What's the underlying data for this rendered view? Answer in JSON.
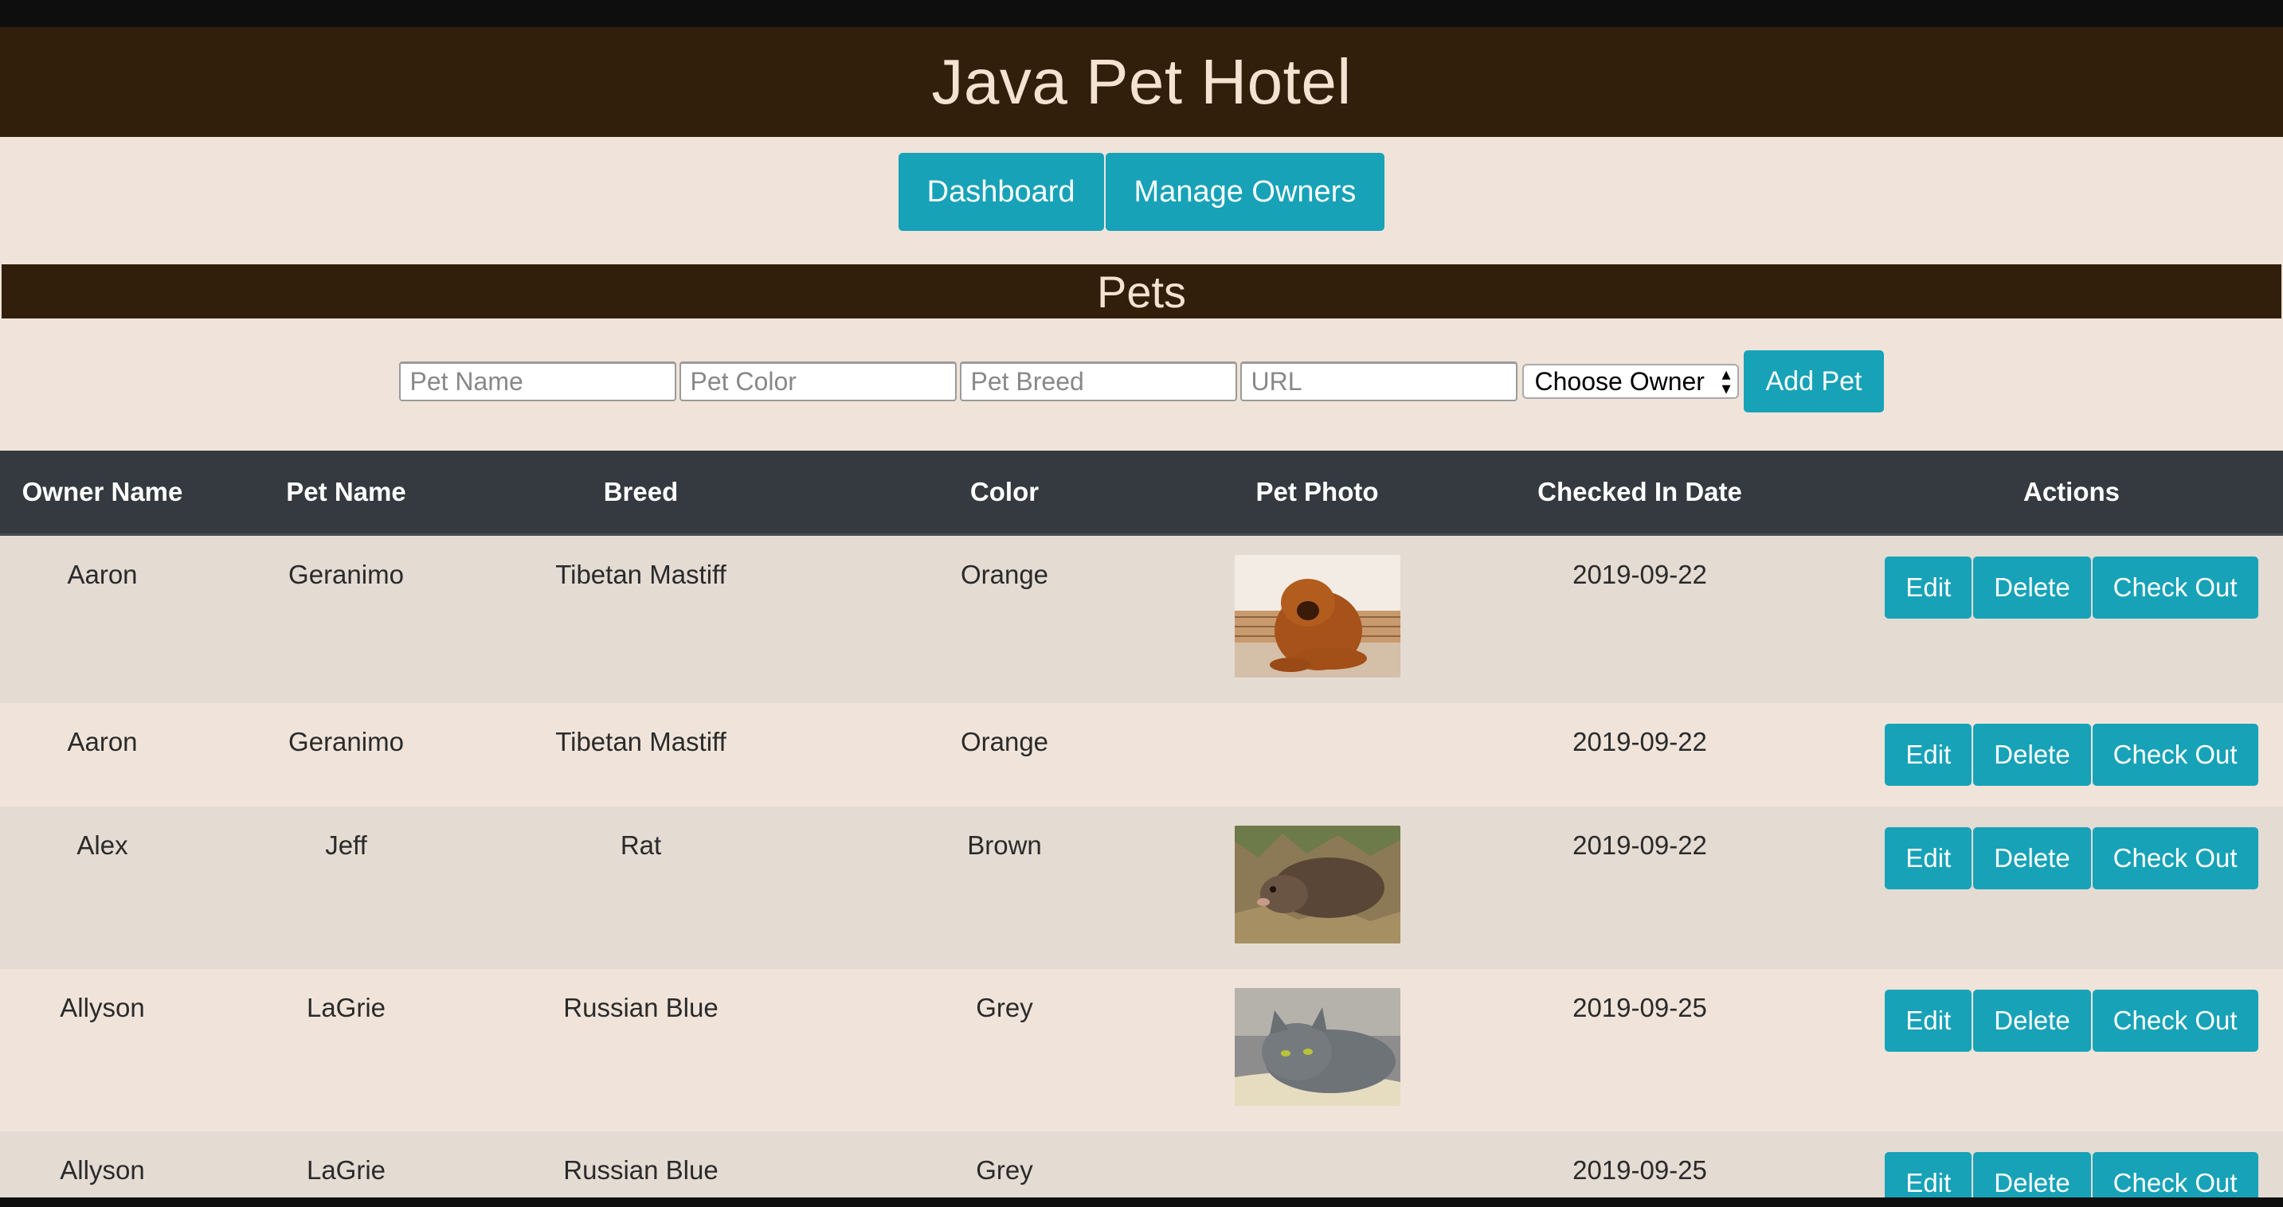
{
  "app": {
    "title": "Java Pet Hotel"
  },
  "nav": {
    "dashboard": "Dashboard",
    "manage_owners": "Manage Owners"
  },
  "section": {
    "title": "Pets"
  },
  "form": {
    "pet_name_placeholder": "Pet Name",
    "pet_color_placeholder": "Pet Color",
    "pet_breed_placeholder": "Pet Breed",
    "url_placeholder": "URL",
    "owner_select": "Choose Owner",
    "add_button": "Add Pet"
  },
  "table": {
    "headers": [
      "Owner Name",
      "Pet Name",
      "Breed",
      "Color",
      "Pet Photo",
      "Checked In Date",
      "Actions"
    ],
    "action_labels": {
      "edit": "Edit",
      "delete": "Delete",
      "checkout": "Check Out"
    },
    "rows": [
      {
        "owner": "Aaron",
        "pet": "Geranimo",
        "breed": "Tibetan Mastiff",
        "color": "Orange",
        "photo": "tibetan-mastiff-photo",
        "date": "2019-09-22"
      },
      {
        "owner": "Aaron",
        "pet": "Geranimo",
        "breed": "Tibetan Mastiff",
        "color": "Orange",
        "photo": "",
        "date": "2019-09-22"
      },
      {
        "owner": "Alex",
        "pet": "Jeff",
        "breed": "Rat",
        "color": "Brown",
        "photo": "rat-photo",
        "date": "2019-09-22"
      },
      {
        "owner": "Allyson",
        "pet": "LaGrie",
        "breed": "Russian Blue",
        "color": "Grey",
        "photo": "russian-blue-cat-photo",
        "date": "2019-09-25"
      },
      {
        "owner": "Allyson",
        "pet": "LaGrie",
        "breed": "Russian Blue",
        "color": "Grey",
        "photo": "",
        "date": "2019-09-25"
      }
    ]
  },
  "colors": {
    "header_bg": "#321f0b",
    "page_bg": "#f0e4da",
    "accent": "#17a2b8",
    "table_head_bg": "#343a40"
  }
}
